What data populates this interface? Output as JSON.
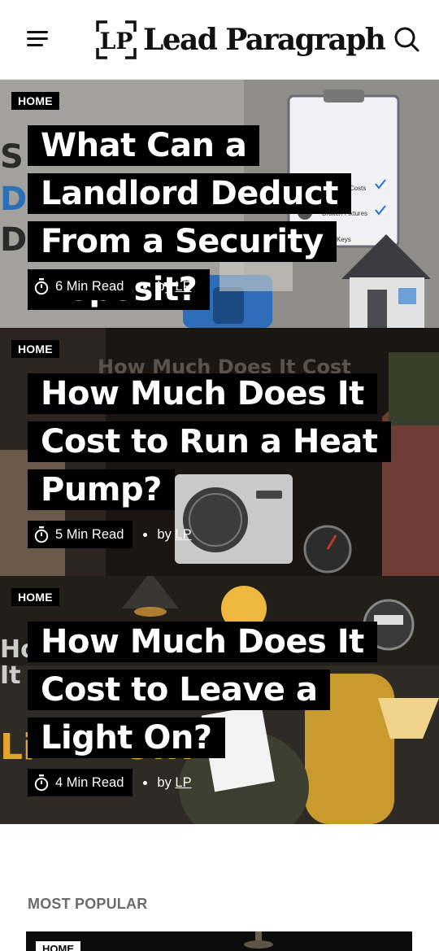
{
  "header": {
    "menu_icon": "hamburger-menu-icon",
    "logo_mark": "LP",
    "logo_text": "Lead Paragraph",
    "search_icon": "search-icon"
  },
  "articles": [
    {
      "category": "HOME",
      "title": "What Can a Landlord Deduct From a Security Deposit?",
      "read_time": "6 Min Read",
      "by_prefix": "by",
      "author": "LP",
      "image_text": [
        "Cleaning Costs",
        "Broken Fixtures",
        "Keys"
      ]
    },
    {
      "category": "HOME",
      "title": "How Much Does It Cost to Run a Heat Pump?",
      "read_time": "5 Min Read",
      "by_prefix": "by",
      "author": "LP",
      "image_text": [
        "How Much Does It Cost"
      ]
    },
    {
      "category": "HOME",
      "title": "How Much Does It Cost to Leave a Light On?",
      "read_time": "4 Min Read",
      "by_prefix": "by",
      "author": "LP",
      "image_text": []
    }
  ],
  "popular": {
    "heading": "MOST POPULAR",
    "first_tag": "HOME"
  },
  "colors": {
    "tag_bg": "#000000",
    "title_bg": "#000000",
    "text_on_dark": "#ffffff",
    "section_heading": "#6b6b6b"
  }
}
